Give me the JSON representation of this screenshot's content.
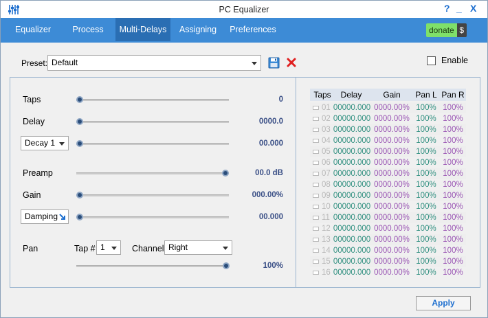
{
  "window": {
    "title": "PC Equalizer",
    "help": "?",
    "minimize": "_",
    "close": "X"
  },
  "tabs": [
    {
      "label": "Equalizer"
    },
    {
      "label": "Process"
    },
    {
      "label": "Multi-Delays"
    },
    {
      "label": "Assigning"
    },
    {
      "label": "Preferences"
    }
  ],
  "active_tab": "Multi-Delays",
  "donate": {
    "label": "donate",
    "sign": "$"
  },
  "preset": {
    "label": "Preset:",
    "value": "Default"
  },
  "enable": {
    "label": "Enable",
    "checked": false
  },
  "controls": {
    "taps": {
      "label": "Taps",
      "value": "0",
      "level": 0
    },
    "delay": {
      "label": "Delay",
      "value": "0000.0",
      "level": 0
    },
    "decay": {
      "select": "Decay 1",
      "value": "00.000",
      "level": 0
    },
    "preamp": {
      "label": "Preamp",
      "value": "00.0 dB",
      "level": 1
    },
    "gain": {
      "label": "Gain",
      "value": "000.00%",
      "level": 0
    },
    "damping": {
      "select": "Damping",
      "value": "00.000",
      "level": 0
    },
    "pan": {
      "label": "Pan",
      "tap_label": "Tap #",
      "tap_value": "1",
      "channel_label": "Channel",
      "channel_value": "Right",
      "value": "100%",
      "level": 1
    }
  },
  "table": {
    "headers": [
      "Taps",
      "Delay",
      "Gain",
      "Pan L",
      "Pan R"
    ],
    "rows": [
      {
        "num": "01",
        "delay": "00000.000",
        "gain": "0000.00%",
        "panl": "100%",
        "panr": "100%"
      },
      {
        "num": "02",
        "delay": "00000.000",
        "gain": "0000.00%",
        "panl": "100%",
        "panr": "100%"
      },
      {
        "num": "03",
        "delay": "00000.000",
        "gain": "0000.00%",
        "panl": "100%",
        "panr": "100%"
      },
      {
        "num": "04",
        "delay": "00000.000",
        "gain": "0000.00%",
        "panl": "100%",
        "panr": "100%"
      },
      {
        "num": "05",
        "delay": "00000.000",
        "gain": "0000.00%",
        "panl": "100%",
        "panr": "100%"
      },
      {
        "num": "06",
        "delay": "00000.000",
        "gain": "0000.00%",
        "panl": "100%",
        "panr": "100%"
      },
      {
        "num": "07",
        "delay": "00000.000",
        "gain": "0000.00%",
        "panl": "100%",
        "panr": "100%"
      },
      {
        "num": "08",
        "delay": "00000.000",
        "gain": "0000.00%",
        "panl": "100%",
        "panr": "100%"
      },
      {
        "num": "09",
        "delay": "00000.000",
        "gain": "0000.00%",
        "panl": "100%",
        "panr": "100%"
      },
      {
        "num": "10",
        "delay": "00000.000",
        "gain": "0000.00%",
        "panl": "100%",
        "panr": "100%"
      },
      {
        "num": "11",
        "delay": "00000.000",
        "gain": "0000.00%",
        "panl": "100%",
        "panr": "100%"
      },
      {
        "num": "12",
        "delay": "00000.000",
        "gain": "0000.00%",
        "panl": "100%",
        "panr": "100%"
      },
      {
        "num": "13",
        "delay": "00000.000",
        "gain": "0000.00%",
        "panl": "100%",
        "panr": "100%"
      },
      {
        "num": "14",
        "delay": "00000.000",
        "gain": "0000.00%",
        "panl": "100%",
        "panr": "100%"
      },
      {
        "num": "15",
        "delay": "00000.000",
        "gain": "0000.00%",
        "panl": "100%",
        "panr": "100%"
      },
      {
        "num": "16",
        "delay": "00000.000",
        "gain": "0000.00%",
        "panl": "100%",
        "panr": "100%"
      }
    ]
  },
  "apply": {
    "label": "Apply"
  },
  "colors": {
    "accent": "#3d8bd6",
    "active_tab": "#2a6eb3",
    "delay_text": "#2f8f7f",
    "gain_text": "#9a56b4",
    "value_text": "#3a4f86"
  }
}
